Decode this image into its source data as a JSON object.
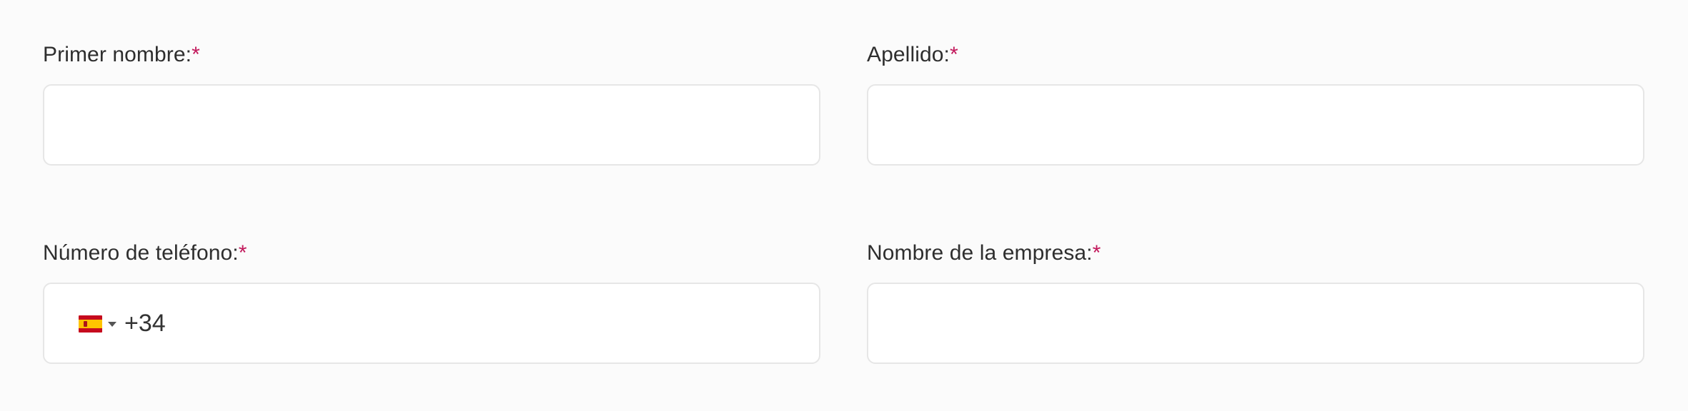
{
  "form": {
    "first_name": {
      "label": "Primer nombre:",
      "required_mark": "*",
      "value": ""
    },
    "last_name": {
      "label": "Apellido:",
      "required_mark": "*",
      "value": ""
    },
    "phone": {
      "label": "Número de teléfono:",
      "required_mark": "*",
      "country_flag_icon": "spain-flag-icon",
      "dropdown_icon": "caret-down-icon",
      "value": "+34"
    },
    "company": {
      "label": "Nombre de la empresa:",
      "required_mark": "*",
      "value": ""
    }
  },
  "colors": {
    "required_mark": "#c2185b",
    "input_border": "#e6e6e6",
    "background": "#fbfbfb"
  }
}
